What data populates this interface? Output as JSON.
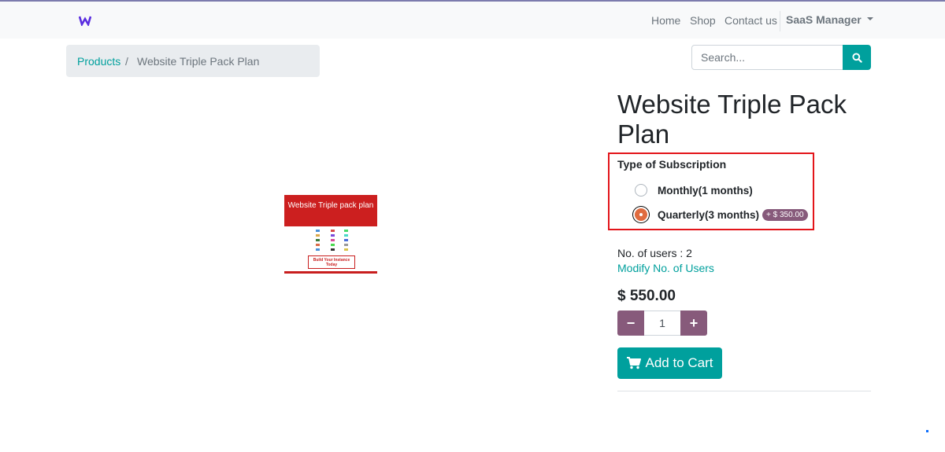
{
  "nav": {
    "logo_icon": "odoo-w-logo-icon",
    "links": [
      "Home",
      "Shop",
      "Contact us"
    ],
    "user_menu": "SaaS Manager"
  },
  "breadcrumb": {
    "parent": "Products",
    "separator": "/",
    "current": "Website Triple Pack Plan"
  },
  "search": {
    "placeholder": "Search...",
    "button_icon": "search-icon"
  },
  "product": {
    "image_title": "Website Triple pack plan",
    "image_cta": "Build Your Instance Today",
    "title": "Website Triple Pack Plan",
    "variant_label": "Type of Subscription",
    "options": [
      {
        "label": "Monthly(1 months)",
        "selected": false
      },
      {
        "label": "Quarterly(3 months)",
        "selected": true,
        "extra_price": "+ $ 350.00"
      }
    ],
    "users_text": "No. of users : 2",
    "modify_link": "Modify No. of Users",
    "price": "$ 550.00",
    "quantity": "1",
    "minus_label": "−",
    "plus_label": "+",
    "add_to_cart": "Add to Cart"
  },
  "colors": {
    "primary": "#00a09d",
    "secondary": "#875a7b",
    "highlight": "#e3151a"
  }
}
